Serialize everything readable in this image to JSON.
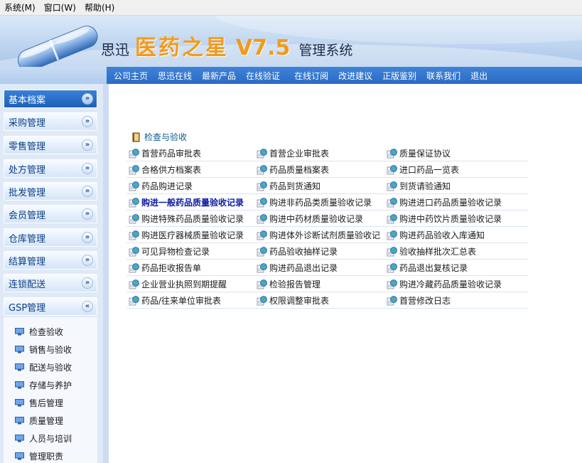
{
  "menubar": [
    "系统(M)",
    "窗口(W)",
    "帮助(H)"
  ],
  "header": {
    "brand_prefix": "思迅",
    "brand_main": "医药之星",
    "brand_version": "V7.5",
    "brand_suffix": "管理系统"
  },
  "nav": [
    "公司主页",
    "思迅在线",
    "最新产品",
    "在线验证",
    "在线订阅",
    "改进建议",
    "正版鉴别",
    "联系我们",
    "退出"
  ],
  "sidebar": {
    "categories": [
      {
        "label": "基本档案",
        "chevron": "»",
        "active": true
      },
      {
        "label": "采购管理",
        "chevron": "»",
        "active": false
      },
      {
        "label": "零售管理",
        "chevron": "»",
        "active": false
      },
      {
        "label": "处方管理",
        "chevron": "»",
        "active": false
      },
      {
        "label": "批发管理",
        "chevron": "»",
        "active": false
      },
      {
        "label": "会员管理",
        "chevron": "»",
        "active": false
      },
      {
        "label": "仓库管理",
        "chevron": "»",
        "active": false
      },
      {
        "label": "结算管理",
        "chevron": "»",
        "active": false
      },
      {
        "label": "连锁配送",
        "chevron": "»",
        "active": false
      },
      {
        "label": "GSP管理",
        "chevron": "«",
        "active": false,
        "expanded": true
      }
    ],
    "sub_items": [
      "检查验收",
      "销售与验收",
      "配送与验收",
      "存储与养护",
      "售后管理",
      "质量管理",
      "人员与培训",
      "管理职责"
    ]
  },
  "content": {
    "section_title": "检查与验收",
    "rows": [
      [
        "首营药品审批表",
        "首营企业审批表",
        "质量保证协议"
      ],
      [
        "合格供方档案表",
        "药品质量档案表",
        "进口药品一览表"
      ],
      [
        "药品购进记录",
        "药品到货通知",
        "到货请验通知"
      ],
      [
        "购进一般药品质量验收记录",
        "购进非药品类质量验收记录",
        "购进进口药品质量验收记录"
      ],
      [
        "购进特殊药品质量验收记录",
        "购进中药材质量验收记录",
        "购进中药饮片质量验收记录"
      ],
      [
        "购进医疗器械质量验收记录",
        "购进体外诊断试剂质量验收记",
        "购进药品验收入库通知"
      ],
      [
        "可见异物检查记录",
        "药品验收抽样记录",
        "验收抽样批次汇总表"
      ],
      [
        "药品拒收报告单",
        "购进药品退出记录",
        "药品退出复核记录"
      ],
      [
        "企业营业执照到期提醒",
        "检验报告管理",
        "购进冷藏药品质量验收记录"
      ],
      [
        "药品/往来单位审批表",
        "权限调整审批表",
        "首营修改日志"
      ]
    ],
    "highlighted": "购进一般药品质量验收记录"
  },
  "colors": {
    "nav_bar": "#2f74cc",
    "brand_orange": "#f39a1c",
    "active_category": "#1c5fb8",
    "highlight_text": "#0b1aa0",
    "section_title": "#0f5b8a"
  },
  "icons": {
    "category_toggle": "chevron-circle-icon",
    "sub_item": "monitor-icon",
    "section": "book-icon",
    "row_item": "document-globe-icon"
  }
}
